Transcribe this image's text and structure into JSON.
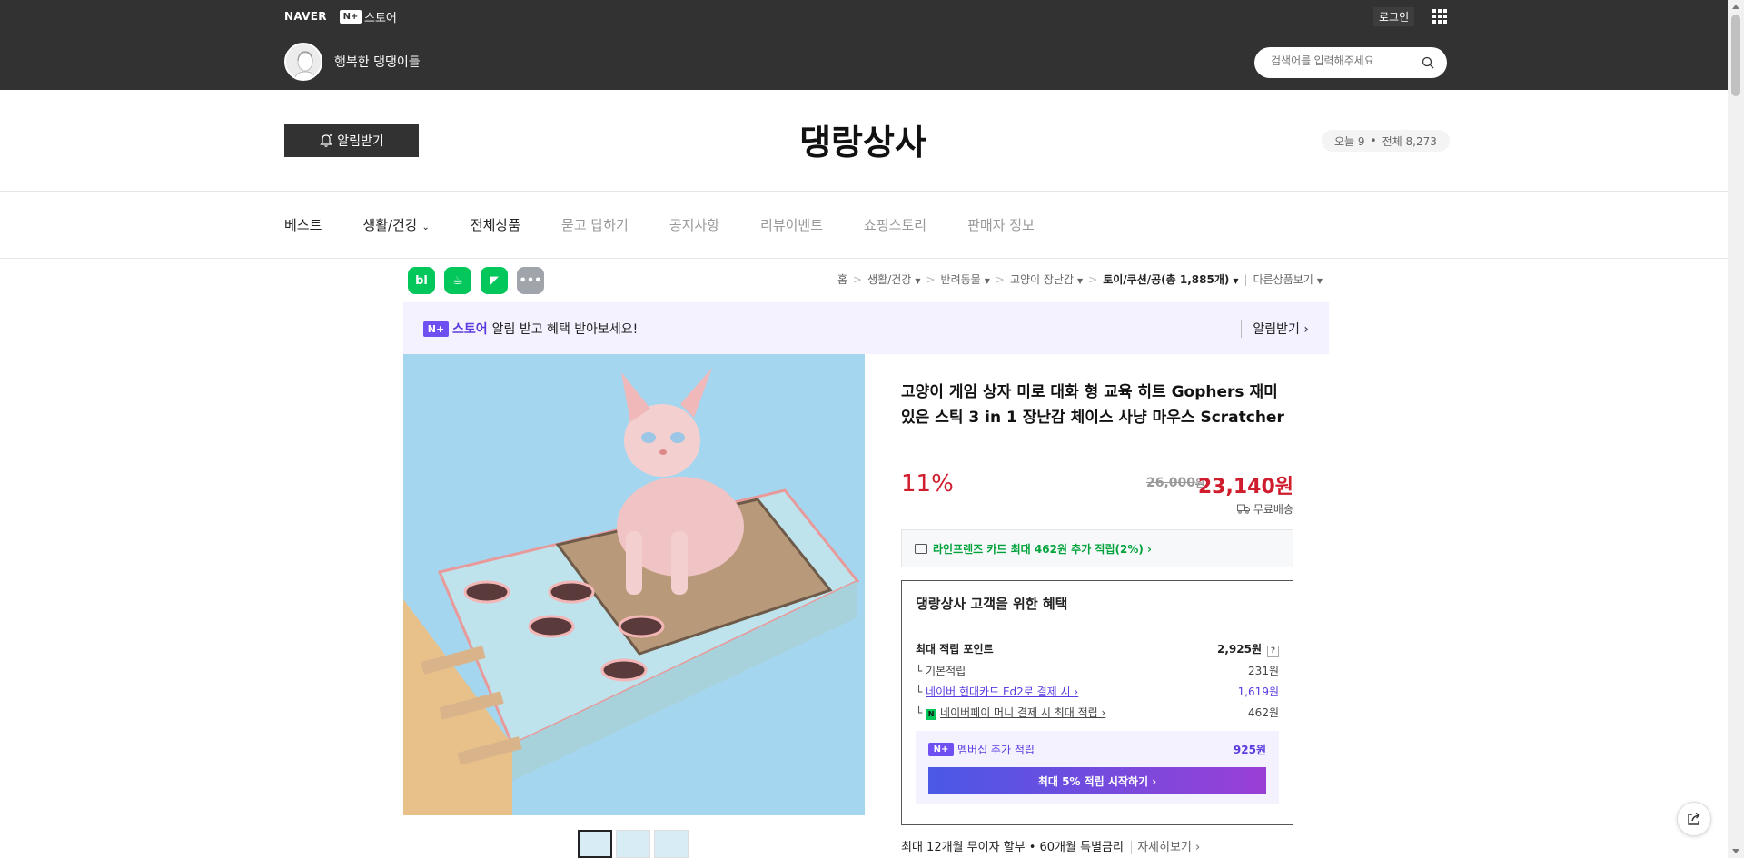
{
  "topbar": {
    "naver": "NAVER",
    "nplus_badge": "N+",
    "nplus_store": "스토어",
    "login": "로그인",
    "store_name": "행복한 댕댕이들",
    "search_placeholder": "검색어를 입력해주세요"
  },
  "header": {
    "alarm": "알림받기",
    "title": "댕랑상사",
    "today_label": "오늘 9",
    "total_label": "전체 8,273",
    "dot": "•"
  },
  "nav": {
    "items": [
      "베스트",
      "생활/건강",
      "전체상품",
      "묻고 답하기",
      "공지사항",
      "리뷰이벤트",
      "쇼핑스토리",
      "판매자 정보"
    ]
  },
  "breadcrumb": {
    "items": [
      "홈",
      "생활/건강",
      "반려동물",
      "고양이 장난감",
      "토이/쿠션/공(총 1,885개)",
      "다른상품보기"
    ]
  },
  "sns": [
    "bl",
    "☕",
    "◤",
    "•••"
  ],
  "promo": {
    "badge": "N+",
    "store": "스토어",
    "text": "알림 받고 혜택 받아보세요!",
    "right": "알림받기 ›"
  },
  "product": {
    "title": "고양이 게임 상자 미로 대화 형 교육 히트 Gophers 재미 있은 스틱 3 in 1 장난감 체이스 사냥 마우스 Scratcher",
    "discount": "11%",
    "original_price": "26,000",
    "original_unit": "원",
    "price": "23,140원",
    "shipping": "무료배송",
    "card_offer": "라인프렌즈 카드 최대 462원 추가 적립(2%) ›"
  },
  "benefit": {
    "title": "댕랑상사 고객을 위한 혜택",
    "max_points_label": "최대 적립 포인트",
    "max_points": "2,925원",
    "q": "?",
    "basic_label": "기본적립",
    "basic": "231원",
    "card_label": "네이버 현대카드 Ed2로 결제 시 ›",
    "card": "1,619원",
    "pay_label": "네이버페이 머니 결제 시 최대 적립 ›",
    "pay_badge": "N",
    "pay": "462원",
    "member_badge": "N+",
    "member_label": "멤버십 추가 적립",
    "member_value": "925원",
    "member_cta": "최대 5% 적립 시작하기 ›"
  },
  "installment": {
    "text": "최대 12개월 무이자 할부 • 60개월 특별금리",
    "more": "자세히보기 ›"
  },
  "colors": {
    "topbar": "#323232",
    "price_red": "#d01d2e",
    "naver_green": "#03c75a",
    "membership_purple": "#5b3ae0",
    "image_bg": "#a5d6ef"
  }
}
